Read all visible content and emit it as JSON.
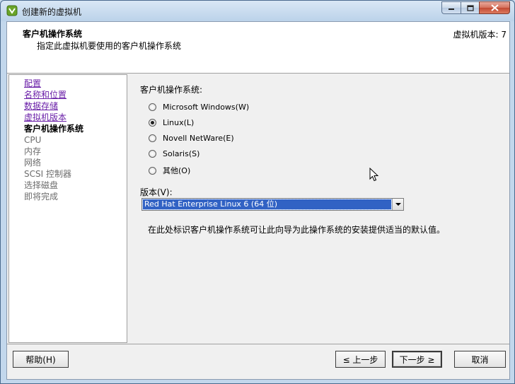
{
  "window": {
    "title": "创建新的虚拟机",
    "icon": "vmware-logo-icon",
    "controls": {
      "minimize": "minimize-icon",
      "maximize": "maximize-icon",
      "close": "close-icon"
    }
  },
  "header": {
    "title": "客户机操作系统",
    "subtitle": "指定此虚拟机要使用的客户机操作系统",
    "version": "虚拟机版本: 7"
  },
  "nav": {
    "items": [
      {
        "label": "配置",
        "state": "link"
      },
      {
        "label": "名称和位置",
        "state": "link"
      },
      {
        "label": "数据存储",
        "state": "link"
      },
      {
        "label": "虚拟机版本",
        "state": "link"
      },
      {
        "label": "客户机操作系统",
        "state": "current"
      },
      {
        "label": "CPU",
        "state": "future"
      },
      {
        "label": "内存",
        "state": "future"
      },
      {
        "label": "网络",
        "state": "future"
      },
      {
        "label": "SCSI 控制器",
        "state": "future"
      },
      {
        "label": "选择磁盘",
        "state": "future"
      },
      {
        "label": "即将完成",
        "state": "future"
      }
    ]
  },
  "content": {
    "os_label": "客户机操作系统:",
    "os_options": [
      {
        "label": "Microsoft Windows(W)",
        "checked": false
      },
      {
        "label": "Linux(L)",
        "checked": true
      },
      {
        "label": "Novell NetWare(E)",
        "checked": false
      },
      {
        "label": "Solaris(S)",
        "checked": false
      },
      {
        "label": "其他(O)",
        "checked": false
      }
    ],
    "version_label": "版本(V):",
    "version_value": "Red Hat Enterprise Linux 6 (64 位)",
    "hint": "在此处标识客户机操作系统可让此向导为此操作系统的安装提供适当的默认值。"
  },
  "footer": {
    "help": "帮助(H)",
    "back": "≤ 上一步",
    "next": "下一步 ≥",
    "cancel": "取消"
  },
  "colors": {
    "link": "#6a1fa8",
    "selection": "#3162c4",
    "close_button": "#c24a33"
  }
}
